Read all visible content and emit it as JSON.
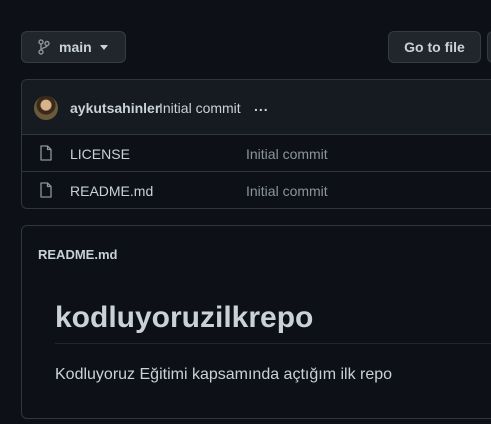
{
  "toolbar": {
    "branch_label": "main",
    "goto_file_label": "Go to file"
  },
  "latest_commit": {
    "author": "aykutsahinler",
    "message": "Initial commit",
    "more": "..."
  },
  "files": [
    {
      "name": "LICENSE",
      "commit": "Initial commit"
    },
    {
      "name": "README.md",
      "commit": "Initial commit"
    }
  ],
  "readme": {
    "file_title": "README.md",
    "heading": "kodluyoruzilkrepo",
    "body": "Kodluyoruz Eğitimi kapsamında açtığım ilk repo"
  },
  "colors": {
    "background": "#0d1117",
    "button_bg": "#21262d",
    "border": "#30363d",
    "text": "#c9d1d9",
    "muted_text": "#8b949e"
  }
}
